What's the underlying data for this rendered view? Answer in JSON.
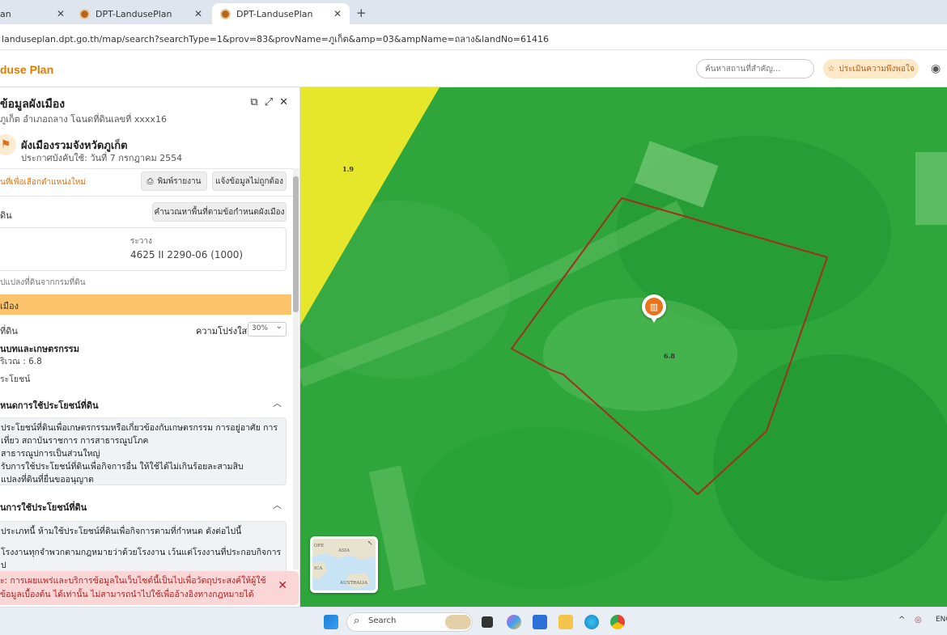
{
  "browser": {
    "tabs": [
      {
        "label": "an"
      },
      {
        "label": "DPT-LandusePlan"
      },
      {
        "label": "DPT-LandusePlan"
      }
    ],
    "url": "landuseplan.dpt.go.th/map/search?searchType=1&prov=83&provName=ภูเก็ต&amp=03&ampName=ถลาง&landNo=61416"
  },
  "app": {
    "logo": "duse Plan",
    "search_placeholder": "ค้นหาสถานที่สำคัญ...",
    "assess_button": "ประเมินความพึงพอใจ"
  },
  "panel": {
    "title": "ข้อมูลผังเมือง",
    "subtitle": "ภูเก็ต อำเภอถลาง โฉนดที่ดินเลขที่ xxxx16",
    "plan_name": "ผังเมืองรวมจังหวัดภูเก็ต",
    "plan_date": "ประกาศบังคับใช้: วันที่ 7 กรกฎาคม 2554",
    "select_new_location": "นที่เพื่อเลือกตำแหน่งใหม่",
    "print_button": "พิมพ์รายงาน",
    "report_button": "แจ้งข้อมูลไม่ถูกต้อง",
    "row_label": "ดิน",
    "calc_button": "คำนวณหาพื้นที่ตามข้อกำหนดผังเมือง",
    "sheet_label": "ระวาง",
    "sheet_value": "4625 II 2290-06 (1000)",
    "conversion_note": "ปแปลงที่ดินจากกรมที่ดิน",
    "zone_bar": "เมือง",
    "land_label": "ที่ดิน",
    "transparency_label": "ความโปร่งใส",
    "transparency_value": "30%",
    "zone_type": "นบทและเกษตรกรรม",
    "zone_area": "ริเวณ : 6.8",
    "benefit_label": "ระโยชน์",
    "section1_title": "หนดการใช้ประโยชน์ที่ดิน",
    "section1_lines": [
      "ประโยชน์ที่ดินเพื่อเกษตรกรรมหรือเกี่ยวข้องกับเกษตรกรรม การอยู่อาศัย การ",
      "เที่ยว สถาบันราชการ การสาธารณูปโภค",
      "สาธารณูปการเป็นส่วนใหญ่",
      "รับการใช้ประโยชน์ที่ดินเพื่อกิจการอื่น ให้ใช้ได้ไม่เกินร้อยละสามสิบ",
      "แปลงที่ดินที่ยื่นขออนุญาต"
    ],
    "section2_title": "นการใช้ประโยชน์ที่ดิน",
    "section2_lines": [
      "ประเภทนี้ ห้ามใช้ประโยชน์ที่ดินเพื่อกิจการตามที่กำหนด ดังต่อไปนี้",
      "",
      "โรงงานทุกจำพวกตามกฎหมายว่าด้วยโรงงาน เว้นแต่โรงงานที่ประกอบกิจการ",
      "ป"
    ],
    "notice_lines": [
      "ะ: การเผยแพร่และบริการข้อมูลในเว็บไซต์นี้เป็นไปเพื่อวัตถุประสงค์ให้ผู้ใช้",
      "ข้อมูลเบื้องต้น ได้เท่านั้น ไม่สามารถนำไปใช้เพื่ออ้างอิงทางกฎหมายได้"
    ]
  },
  "map": {
    "zone_label_yellow": "1.9",
    "zone_label_parcel": "6.8",
    "minimap_labels": [
      "OPE",
      "ASIA",
      "ICA",
      "AUSTRALIA"
    ],
    "colors": {
      "yellow_zone": "#e6e62b",
      "green_zone": "#2ea63c",
      "parcel_outline": "#a0301e",
      "pin": "#e8731a"
    }
  },
  "taskbar": {
    "search_label": "Search",
    "tray_lang": "ENG"
  }
}
